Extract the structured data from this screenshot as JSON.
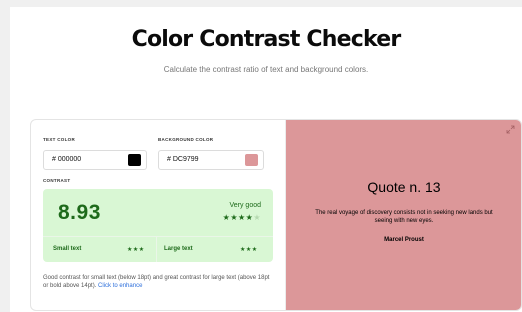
{
  "header": {
    "title": "Color Contrast Checker",
    "subtitle": "Calculate the contrast ratio of text and background colors."
  },
  "text_color": {
    "label": "TEXT COLOR",
    "value": "# 000000",
    "swatch_color": "#000000"
  },
  "background_color": {
    "label": "BACKGROUND COLOR",
    "value": "# DC9799",
    "swatch_color": "#DC9799"
  },
  "contrast": {
    "label": "CONTRAST",
    "ratio": "8.93",
    "rating": "Very good",
    "stars_filled": 4,
    "stars_total": 5,
    "small_text_label": "Small text",
    "small_text_stars": "★★★",
    "large_text_label": "Large text",
    "large_text_stars": "★★★",
    "box_color": "#d9f7d4",
    "accent_color": "#1d6a1a"
  },
  "note": {
    "text": "Good contrast for small text (below 18pt) and great contrast for large text (above 18pt or bold above 14pt).",
    "link": "Click to enhance"
  },
  "preview": {
    "title": "Quote n. 13",
    "quote": "The real voyage of discovery consists not in seeking new lands but seeing with new eyes.",
    "author": "Marcel Proust",
    "background": "#DC9799",
    "text_color": "#000000",
    "expand_icon": "expand-icon"
  }
}
